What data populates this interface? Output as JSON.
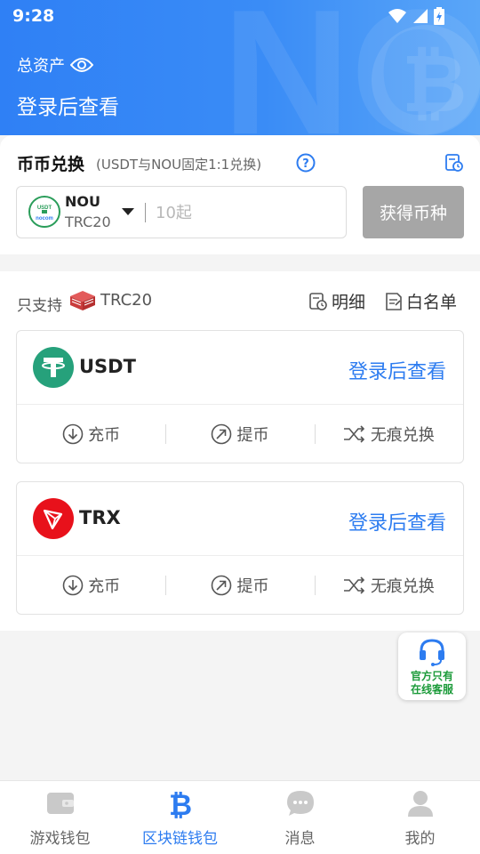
{
  "status_bar": {
    "time": "9:28"
  },
  "header": {
    "assets_label": "总资产",
    "assets_value": "登录后查看"
  },
  "exchange": {
    "title": "币币兑换",
    "note": "(USDT与NOU固定1:1兑换)",
    "coin": {
      "name": "NOU",
      "network": "TRC20",
      "logo_text": "USDT NOU"
    },
    "amount_placeholder": "10起",
    "get_button": "获得币种"
  },
  "wallet": {
    "support_label": "只支持",
    "support_chain": "TRC20",
    "detail_label": "明细",
    "whitelist_label": "白名单",
    "cards": [
      {
        "name": "USDT",
        "value": "登录后查看",
        "color": "#26a17b",
        "icon": "tether-icon",
        "actions": [
          "充币",
          "提币",
          "无痕兑换"
        ]
      },
      {
        "name": "TRX",
        "value": "登录后查看",
        "color": "#e8111b",
        "icon": "tron-icon",
        "actions": [
          "充币",
          "提币",
          "无痕兑换"
        ]
      }
    ]
  },
  "service": {
    "line1": "官方只有",
    "line2": "在线客服"
  },
  "nav": {
    "items": [
      {
        "label": "游戏钱包",
        "icon": "wallet-icon",
        "active": false
      },
      {
        "label": "区块链钱包",
        "icon": "bitcoin-icon",
        "active": true
      },
      {
        "label": "消息",
        "icon": "chat-icon",
        "active": false
      },
      {
        "label": "我的",
        "icon": "user-icon",
        "active": false
      }
    ]
  },
  "colors": {
    "primary": "#2d7cf0",
    "header": "#3a8cf6",
    "disabled_button": "#a6a6a6",
    "service_text": "#1c9b3a"
  }
}
